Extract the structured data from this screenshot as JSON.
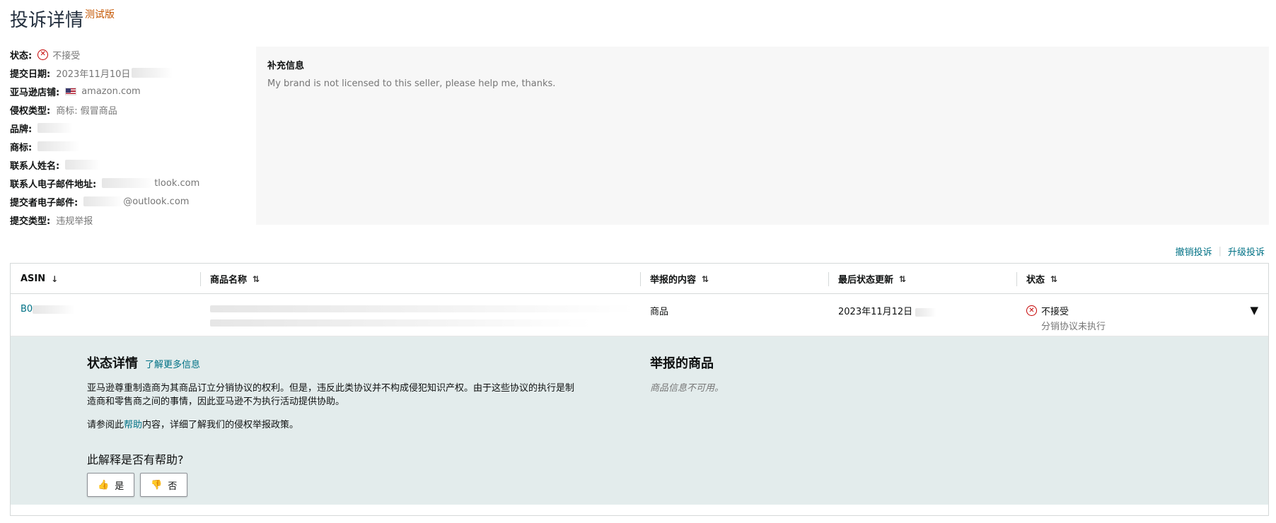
{
  "page": {
    "title": "投诉详情",
    "badge": "测试版"
  },
  "details": [
    {
      "label": "状态:",
      "value": "不接受",
      "icon": "x-circle-icon"
    },
    {
      "label": "提交日期:",
      "value": "2023年11月10日"
    },
    {
      "label": "亚马逊店铺:",
      "value": "amazon.com",
      "icon": "us-flag-icon"
    },
    {
      "label": "侵权类型:",
      "value": "商标: 假冒商品"
    },
    {
      "label": "品牌:",
      "value": ""
    },
    {
      "label": "商标:",
      "value": ""
    },
    {
      "label": "联系人姓名:",
      "value": ""
    },
    {
      "label": "联系人电子邮件地址:",
      "value": "tlook.com"
    },
    {
      "label": "提交者电子邮件:",
      "value": "@outlook.com"
    },
    {
      "label": "提交类型:",
      "value": "违规举报"
    }
  ],
  "info": {
    "title": "补充信息",
    "text": "My brand is not licensed to this seller, please help me, thanks."
  },
  "actions": {
    "withdraw": "撤销投诉",
    "escalate": "升级投诉"
  },
  "table": {
    "headers": {
      "asin": "ASIN",
      "product_name": "商品名称",
      "reported_content": "举报的内容",
      "last_update": "最后状态更新",
      "status": "状态"
    },
    "row": {
      "asin": "B0",
      "reported_content": "商品",
      "last_update": "2023年11月12日",
      "status": "不接受",
      "status_sub": "分销协议未执行"
    }
  },
  "panel": {
    "heading": "状态详情",
    "learn_more": "了解更多信息",
    "para1": "亚马逊尊重制造商为其商品订立分销协议的权利。但是，违反此类协议并不构成侵犯知识产权。由于这些协议的执行是制造商和零售商之间的事情，因此亚马逊不为执行活动提供协助。",
    "para2_before": "请参阅此",
    "para2_link": "帮助",
    "para2_after": "内容，详细了解我们的侵权举报政策。",
    "helpful_question": "此解释是否有帮助?",
    "yes": "是",
    "no": "否",
    "reported_heading": "举报的商品",
    "reported_unavailable": "商品信息不可用。"
  },
  "colors": {
    "link": "#007185",
    "error": "#c40000",
    "panel_bg": "#e3ecec",
    "beta": "#c45500"
  }
}
